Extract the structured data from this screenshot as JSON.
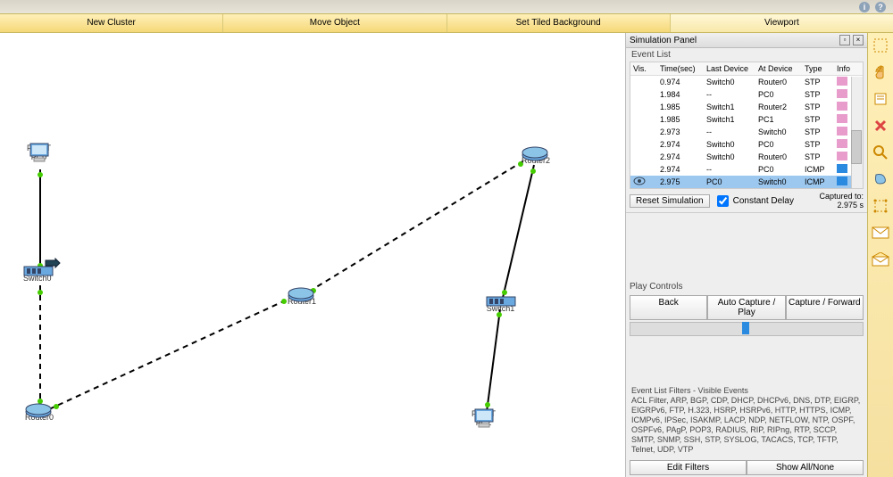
{
  "toolbar": {
    "new_cluster": "New Cluster",
    "move_object": "Move Object",
    "set_tiled_bg": "Set Tiled Background",
    "viewport": "Viewport"
  },
  "devices": {
    "pc0": {
      "type": "PC-PT",
      "name": "PC0"
    },
    "switch0": {
      "type": "2950",
      "name": "Switch0"
    },
    "router0": {
      "type": "1841",
      "name": "Router0"
    },
    "router1": {
      "type": "1841",
      "name": "Router1"
    },
    "router2": {
      "type": "1841",
      "name": "Router2"
    },
    "switch1": {
      "type": "2950-24",
      "name": "Switch1"
    },
    "pc1": {
      "type": "PC-PT",
      "name": "PC1"
    }
  },
  "sim_panel": {
    "title": "Simulation Panel",
    "event_list_label": "Event List",
    "columns": {
      "vis": "Vis.",
      "time": "Time(sec)",
      "last": "Last Device",
      "at": "At Device",
      "type": "Type",
      "info": "Info"
    },
    "events": [
      {
        "time": "0.974",
        "last": "Switch0",
        "at": "Router0",
        "type": "STP",
        "color": "#e89ccc"
      },
      {
        "time": "1.984",
        "last": "--",
        "at": "PC0",
        "type": "STP",
        "color": "#e89ccc"
      },
      {
        "time": "1.985",
        "last": "Switch1",
        "at": "Router2",
        "type": "STP",
        "color": "#e89ccc"
      },
      {
        "time": "1.985",
        "last": "Switch1",
        "at": "PC1",
        "type": "STP",
        "color": "#e89ccc"
      },
      {
        "time": "2.973",
        "last": "--",
        "at": "Switch0",
        "type": "STP",
        "color": "#e89ccc"
      },
      {
        "time": "2.974",
        "last": "Switch0",
        "at": "PC0",
        "type": "STP",
        "color": "#e89ccc"
      },
      {
        "time": "2.974",
        "last": "Switch0",
        "at": "Router0",
        "type": "STP",
        "color": "#e89ccc"
      },
      {
        "time": "2.974",
        "last": "--",
        "at": "PC0",
        "type": "ICMP",
        "color": "#2a8ae0"
      },
      {
        "time": "2.975",
        "last": "PC0",
        "at": "Switch0",
        "type": "ICMP",
        "color": "#2a8ae0",
        "selected": true
      }
    ],
    "reset_btn": "Reset Simulation",
    "constant_delay": "Constant Delay",
    "captured_label": "Captured to:",
    "captured_value": "2.975 s",
    "play_label": "Play Controls",
    "back_btn": "Back",
    "auto_btn": "Auto Capture / Play",
    "fwd_btn": "Capture / Forward",
    "filters_label": "Event List Filters - Visible Events",
    "filters_text": "ACL Filter, ARP, BGP, CDP, DHCP, DHCPv6, DNS, DTP, EIGRP, EIGRPv6, FTP, H.323, HSRP, HSRPv6, HTTP, HTTPS, ICMP, ICMPv6, IPSec, ISAKMP, LACP, NDP, NETFLOW, NTP, OSPF, OSPFv6, PAgP, POP3, RADIUS, RIP, RIPng, RTP, SCCP, SMTP, SNMP, SSH, STP, SYSLOG, TACACS, TCP, TFTP, Telnet, UDP, VTP",
    "edit_filters_btn": "Edit Filters",
    "show_all_btn": "Show All/None"
  },
  "right_tools": [
    "select",
    "hand",
    "note",
    "delete",
    "zoom",
    "shape",
    "resize",
    "envelope-closed",
    "envelope-open"
  ]
}
